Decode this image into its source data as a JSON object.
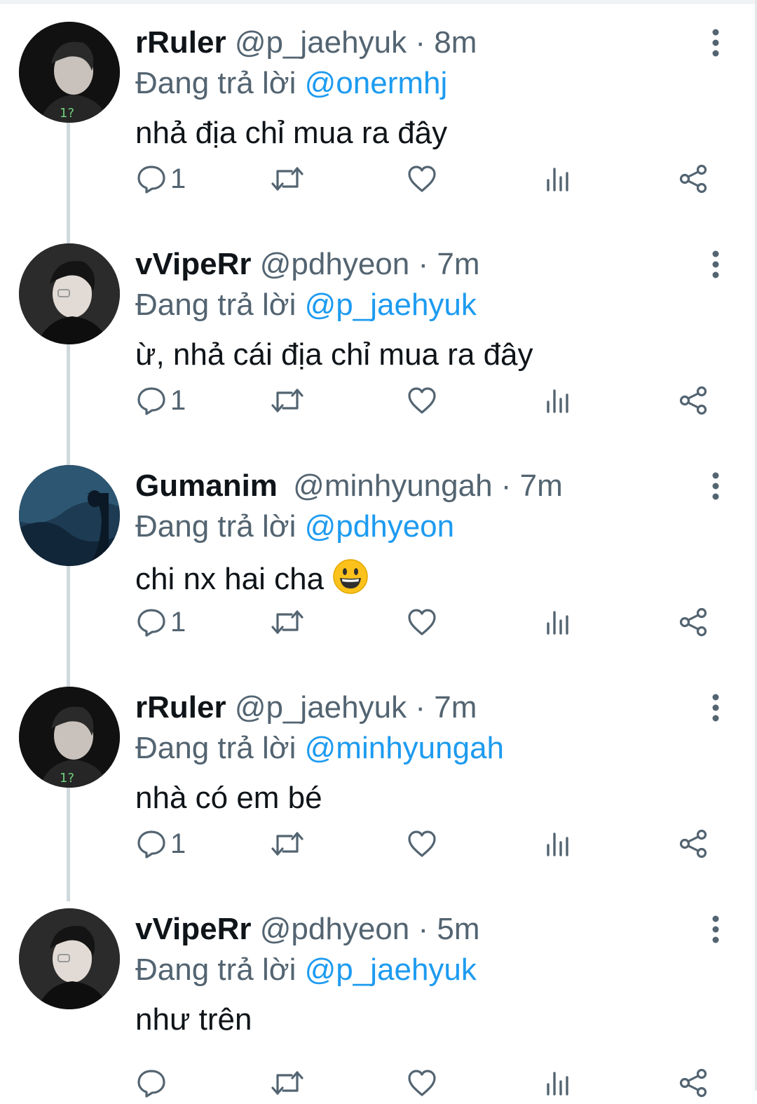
{
  "reply_prefix": "Đang trả lời",
  "colors": {
    "accent": "#1d9bf0",
    "muted": "#536471",
    "text": "#0f1419"
  },
  "tweets": [
    {
      "name": "rRuler",
      "handle": "@p_jaehyuk",
      "sep": "·",
      "time": "8m",
      "reply_to": "@onermhj",
      "text": "nhả địa chỉ mua ra đây",
      "reply_count": "1",
      "avatar": "rruler-avatar"
    },
    {
      "name": "vVipeRr",
      "handle": "@pdhyeon",
      "sep": "·",
      "time": "7m",
      "reply_to": "@p_jaehyuk",
      "text": "ừ, nhả cái địa chỉ mua ra đây",
      "reply_count": "1",
      "avatar": "vviperr-avatar"
    },
    {
      "name": "Gumanim",
      "handle": "@minhyungah",
      "sep": "·",
      "time": "7m",
      "reply_to": "@pdhyeon",
      "text": "chi nx hai cha",
      "emoji": "grinning-face-emoji",
      "reply_count": "1",
      "avatar": "gumanim-avatar"
    },
    {
      "name": "rRuler",
      "handle": "@p_jaehyuk",
      "sep": "·",
      "time": "7m",
      "reply_to": "@minhyungah",
      "text": "nhà có em bé",
      "reply_count": "1",
      "avatar": "rruler-avatar"
    },
    {
      "name": "vVipeRr",
      "handle": "@pdhyeon",
      "sep": "·",
      "time": "5m",
      "reply_to": "@p_jaehyuk",
      "text": "như trên",
      "reply_count": "",
      "avatar": "vviperr-avatar"
    }
  ],
  "icons": [
    "reply-icon",
    "retweet-icon",
    "like-icon",
    "views-icon",
    "share-icon",
    "more-icon"
  ]
}
